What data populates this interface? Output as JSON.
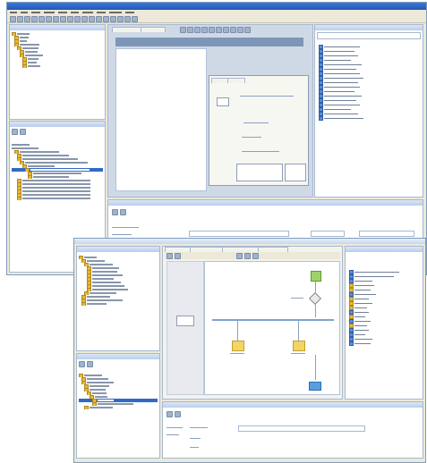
{
  "back_window": {
    "title": "",
    "menu": []
  },
  "front_window": {
    "title": ""
  }
}
